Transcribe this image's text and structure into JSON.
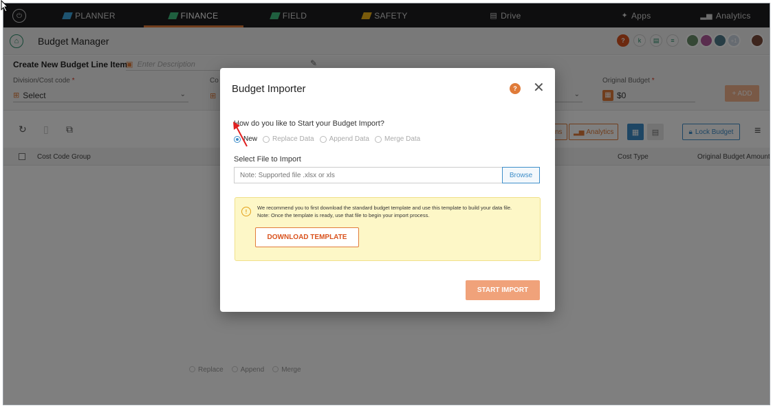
{
  "topnav": {
    "items": [
      {
        "label": "PLANNER",
        "icon": "diamond-icon"
      },
      {
        "label": "FINANCE",
        "icon": "diamond-icon",
        "active": true
      },
      {
        "label": "FIELD",
        "icon": "diamond-icon"
      },
      {
        "label": "SAFETY",
        "icon": "diamond-icon"
      },
      {
        "label": "Drive",
        "icon": "drive-icon"
      },
      {
        "label": "Apps",
        "icon": "apps-icon"
      },
      {
        "label": "Analytics",
        "icon": "analytics-icon"
      }
    ],
    "accent": "#e07b39"
  },
  "header": {
    "title": "Budget Manager",
    "avatar_more": "+1"
  },
  "form": {
    "create_title": "Create New Budget Line Item",
    "description_placeholder": "Enter Description",
    "division_label": "Division/Cost code",
    "division_value": "Select",
    "cost_type_label_partial": "Co",
    "original_budget_label": "Original Budget",
    "original_budget_value": "$0",
    "required_marker": "*",
    "add_label": "+ ADD"
  },
  "toolbar": {
    "partial_label": "ns",
    "analytics_label": "Analytics",
    "lock_label": "Lock Budget"
  },
  "table": {
    "columns": [
      "Cost Code Group",
      "Cost Type",
      "Original Budget Amount"
    ]
  },
  "bottom_radios": [
    "Replace",
    "Append",
    "Merge"
  ],
  "modal": {
    "title": "Budget Importer",
    "question": "How do you like to Start your Budget Import?",
    "options": [
      "New",
      "Replace Data",
      "Append Data",
      "Merge Data"
    ],
    "selected": "New",
    "file_label": "Select File to Import",
    "file_placeholder": "Note: Supported file .xlsx or xls",
    "browse_label": "Browse",
    "notice_line1": "We recommend you to first download the standard budget template and use this template to build your data file.",
    "notice_line2": "Note: Once the template is ready, use that file to begin your import process.",
    "download_label": "DOWNLOAD TEMPLATE",
    "start_label": "START IMPORT"
  }
}
